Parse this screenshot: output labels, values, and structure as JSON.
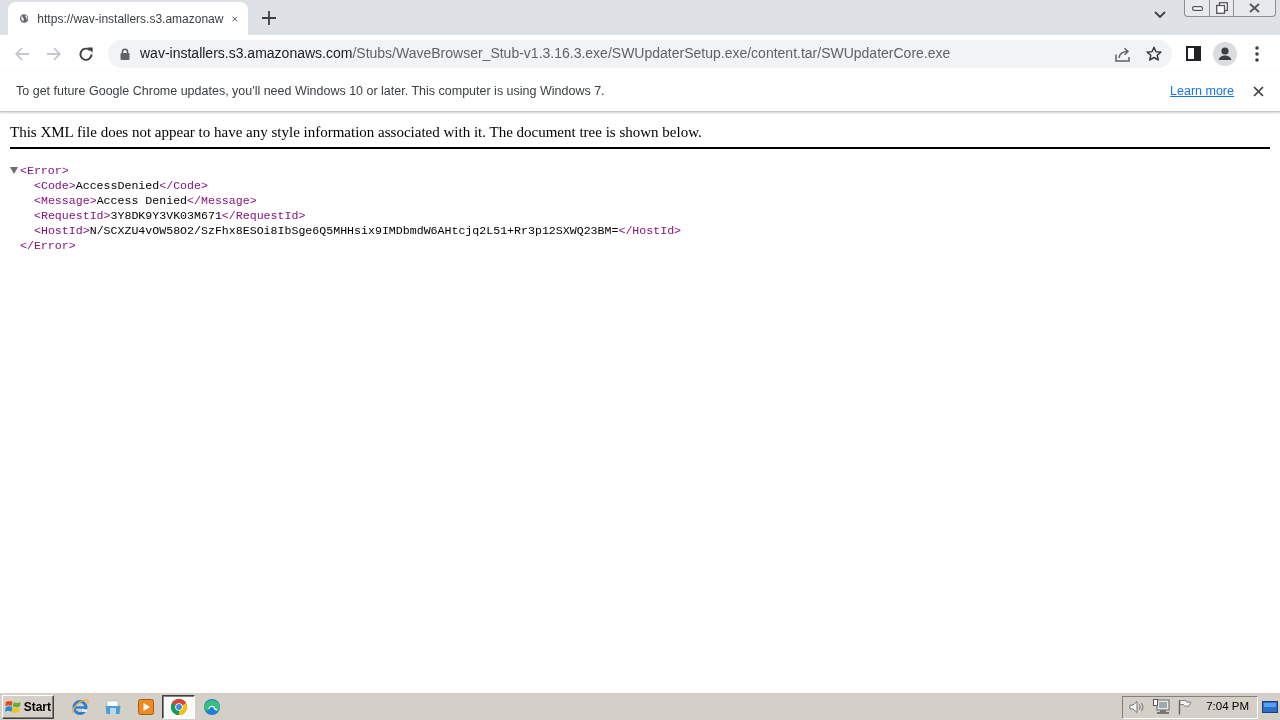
{
  "browser": {
    "tabs": [
      {
        "title": "https://wav-installers.s3.amazonaw",
        "selected": true
      }
    ],
    "toolbar": {
      "nav": [
        {
          "kind": "back",
          "disabled": true
        },
        {
          "kind": "forward",
          "disabled": true
        },
        {
          "kind": "reload",
          "disabled": false
        }
      ],
      "address": {
        "host": "wav-installers.s3.amazonaws.com",
        "path": "/Stubs/WaveBrowser_Stub-v1.3.16.3.exe/SWUpdaterSetup.exe/content.tar/SWUpdaterCore.exe"
      }
    },
    "infobar": {
      "message": "To get future Google Chrome updates, you'll need Windows 10 or later. This computer is using Windows 7.",
      "link": "Learn more"
    }
  },
  "document": {
    "notice": "This XML file does not appear to have any style information associated with it. The document tree is shown below.",
    "root": {
      "open_tag": "<Error>",
      "close_tag": "</Error>",
      "expanded": true,
      "children": [
        {
          "open_tag": "<Code>",
          "text": "AccessDenied",
          "close_tag": "</Code>"
        },
        {
          "open_tag": "<Message>",
          "text": "Access Denied",
          "close_tag": "</Message>"
        },
        {
          "open_tag": "<RequestId>",
          "text": "3Y8DK9Y3VK03M671",
          "close_tag": "</RequestId>"
        },
        {
          "open_tag": "<HostId>",
          "text": "N/SCXZU4vOW58O2/SzFhx8ESOi8IbSge6Q5MHHsix9IMDbmdW6AHtcjq2L51+Rr3p12SXWQ23BM=",
          "close_tag": "</HostId>"
        }
      ]
    }
  },
  "taskbar": {
    "start": "Start",
    "apps": [
      {
        "kind": "ie",
        "selected": false
      },
      {
        "kind": "folder",
        "selected": false
      },
      {
        "kind": "media",
        "selected": false
      },
      {
        "kind": "chrome",
        "selected": true
      },
      {
        "kind": "edge",
        "selected": false
      }
    ],
    "clock": "7:04 PM"
  }
}
